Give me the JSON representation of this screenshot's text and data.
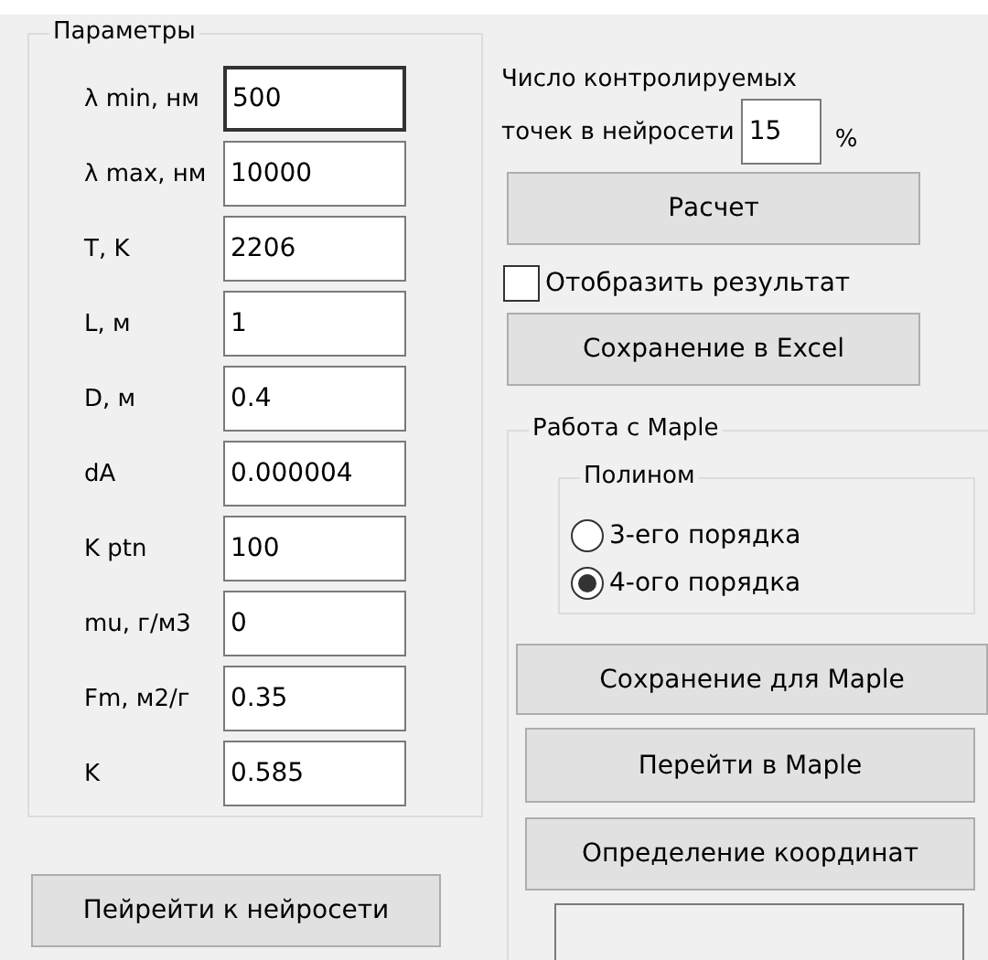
{
  "parameters": {
    "title": "Параметры",
    "fields": [
      {
        "label": "λ min, нм",
        "value": "500",
        "focused": true
      },
      {
        "label": "λ max, нм",
        "value": "10000",
        "focused": false
      },
      {
        "label": "T, K",
        "value": "2206",
        "focused": false
      },
      {
        "label": "L, м",
        "value": "1",
        "focused": false
      },
      {
        "label": "D, м",
        "value": "0.4",
        "focused": false
      },
      {
        "label": "dA",
        "value": "0.000004",
        "focused": false
      },
      {
        "label": "K ptn",
        "value": "100",
        "focused": false
      },
      {
        "label": "mu, г/м3",
        "value": "0",
        "focused": false
      },
      {
        "label": "Fm, м2/г",
        "value": "0.35",
        "focused": false
      },
      {
        "label": "K",
        "value": "0.585",
        "focused": false
      }
    ]
  },
  "neural_button": "Пейрейти к нейросети",
  "points": {
    "label_line1": "Число контролируемых",
    "label_line2": "точек в нейросети",
    "value": "15",
    "unit": "%"
  },
  "calc_button": "Расчет",
  "show_result": {
    "label": "Отобразить результат",
    "checked": false
  },
  "excel_button": "Сохранение в Excel",
  "maple": {
    "title": "Работа с Maple",
    "polynom": {
      "title": "Полином",
      "options": [
        {
          "label": "3-его порядка",
          "selected": false
        },
        {
          "label": "4-ого порядка",
          "selected": true
        }
      ]
    },
    "buttons": [
      "Сохранение для Maple",
      "Перейти в Maple",
      "Определение координат"
    ]
  }
}
